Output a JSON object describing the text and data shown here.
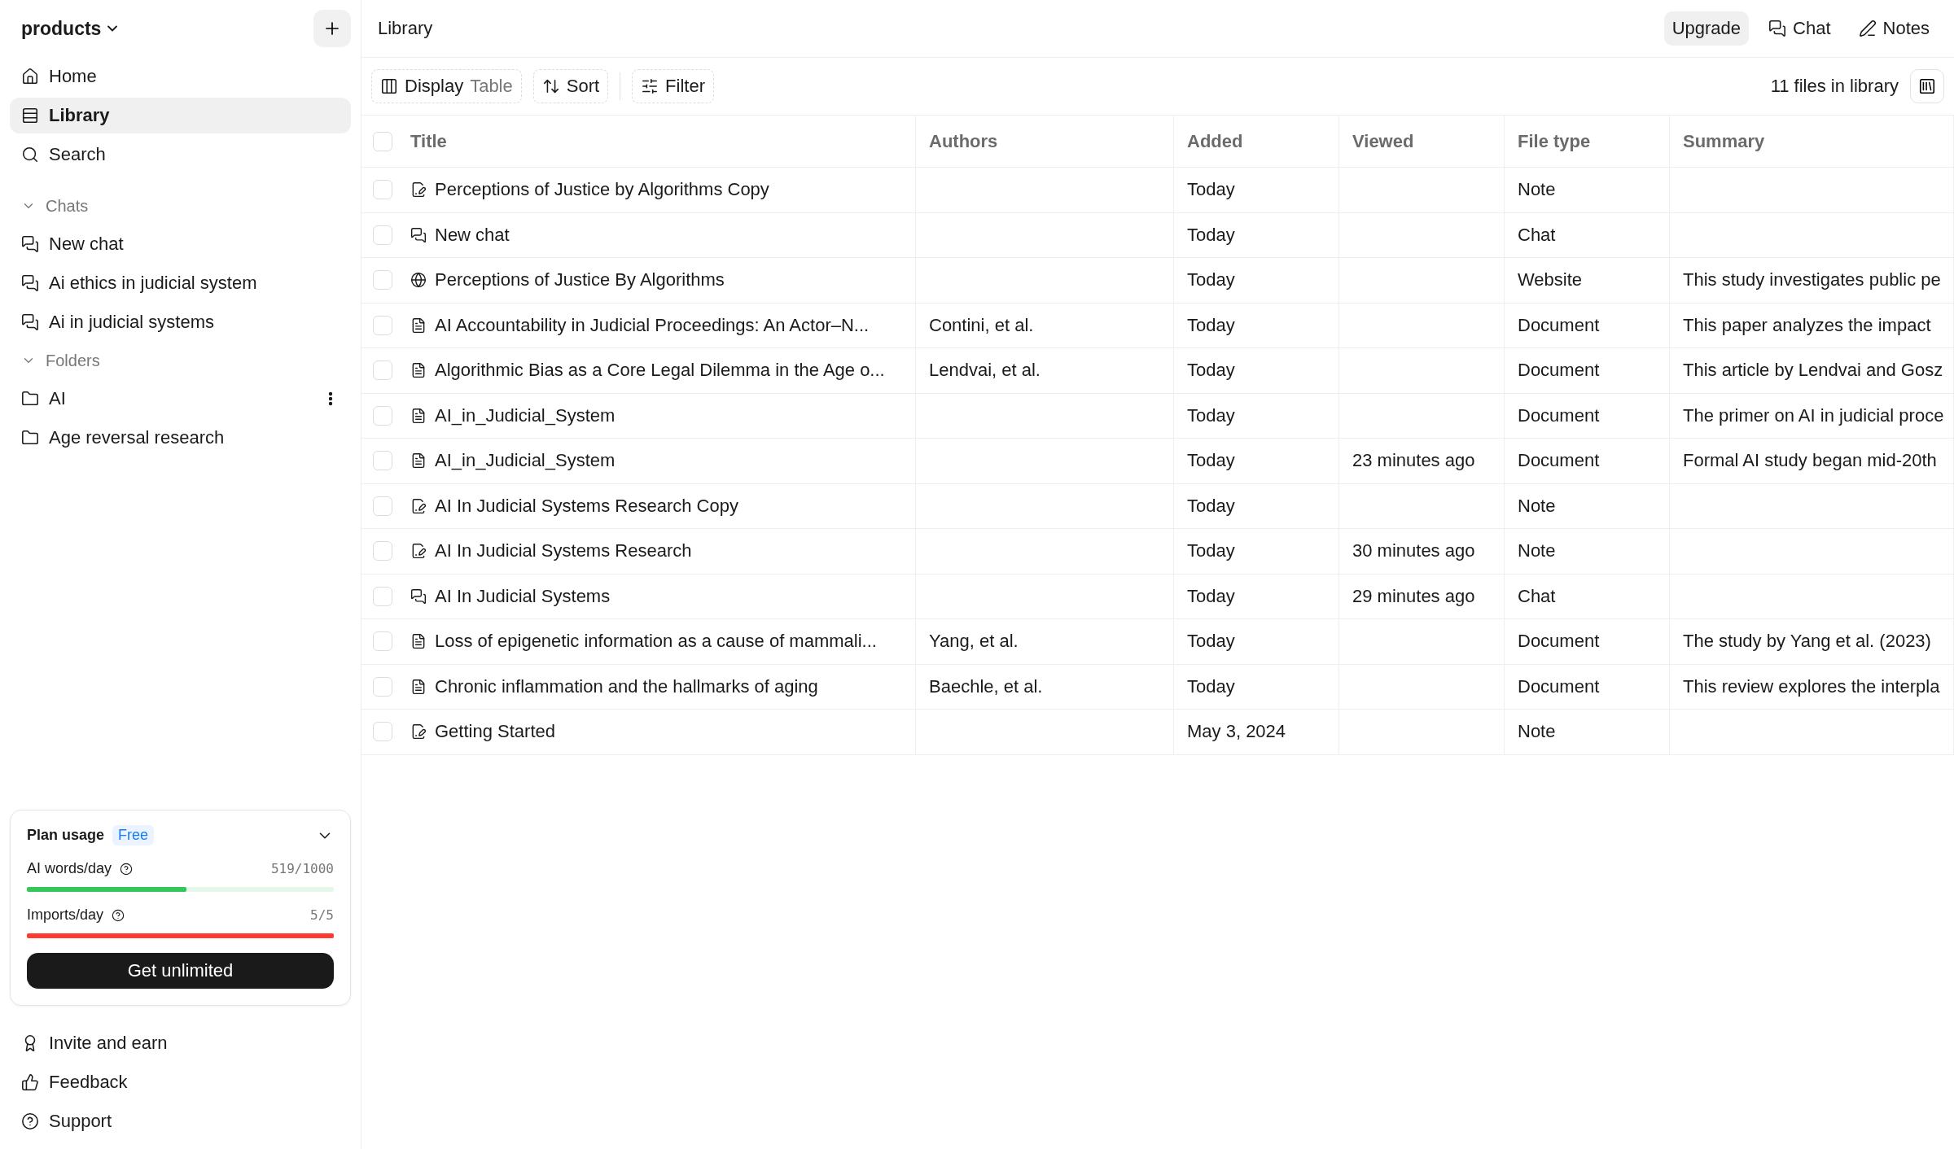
{
  "sidebar": {
    "workspace": "products",
    "nav": [
      {
        "label": "Home",
        "kind": "home",
        "selected": false
      },
      {
        "label": "Library",
        "kind": "library",
        "selected": true
      },
      {
        "label": "Search",
        "kind": "search",
        "selected": false
      }
    ],
    "sections": [
      {
        "title": "Chats",
        "expanded": true,
        "kind": "chat",
        "items": [
          {
            "label": "New chat"
          },
          {
            "label": "Ai ethics in judicial system"
          },
          {
            "label": "Ai in judicial systems"
          }
        ]
      },
      {
        "title": "Folders",
        "expanded": true,
        "kind": "folder",
        "items": [
          {
            "label": "AI",
            "menu": true
          },
          {
            "label": "Age reversal research"
          }
        ]
      }
    ],
    "plan": {
      "title": "Plan usage",
      "badge": "Free",
      "meters": [
        {
          "label": "AI words/day",
          "reading": "519/1000",
          "level": 0.519,
          "color": "#34c759"
        },
        {
          "label": "Imports/day",
          "reading": "5/5",
          "level": 1,
          "color": "#ff3b30"
        }
      ],
      "button": "Get unlimited"
    },
    "footer": [
      {
        "label": "Invite and earn",
        "kind": "award"
      },
      {
        "label": "Feedback",
        "kind": "like"
      },
      {
        "label": "Support",
        "kind": "help"
      }
    ]
  },
  "header": {
    "title": "Library",
    "actions": [
      {
        "label": "Upgrade",
        "kind": "plain"
      },
      {
        "label": "Chat",
        "kind": "chat"
      },
      {
        "label": "Notes",
        "kind": "notes"
      }
    ]
  },
  "toolbar": {
    "display": "Display",
    "display_value": "Table",
    "sort": "Sort",
    "filter": "Filter",
    "count": "11 files in library"
  },
  "table": {
    "columns": [
      "Title",
      "Authors",
      "Added",
      "Viewed",
      "File type",
      "Summary"
    ],
    "header_checked": false,
    "rows": [
      {
        "kind": "note",
        "checked": false,
        "cells": [
          "Perceptions of Justice by Algorithms Copy",
          "",
          "Today",
          "",
          "Note",
          ""
        ]
      },
      {
        "kind": "chat",
        "checked": false,
        "cells": [
          "New chat",
          "",
          "Today",
          "",
          "Chat",
          ""
        ]
      },
      {
        "kind": "website",
        "checked": false,
        "cells": [
          "Perceptions of Justice By Algorithms",
          "",
          "Today",
          "",
          "Website",
          "This study investigates public pe"
        ]
      },
      {
        "kind": "document",
        "checked": false,
        "cells": [
          "AI Accountability in Judicial Proceedings: An Actor–N...",
          "Contini, et al.",
          "Today",
          "",
          "Document",
          "This paper analyzes the impact"
        ]
      },
      {
        "kind": "document",
        "checked": false,
        "cells": [
          "Algorithmic Bias as a Core Legal Dilemma in the Age o...",
          "Lendvai, et al.",
          "Today",
          "",
          "Document",
          "This article by Lendvai and Gosz"
        ]
      },
      {
        "kind": "document",
        "checked": false,
        "cells": [
          "AI_in_Judicial_System",
          "",
          "Today",
          "",
          "Document",
          "The primer on AI in judicial proce"
        ]
      },
      {
        "kind": "document",
        "checked": false,
        "cells": [
          "AI_in_Judicial_System",
          "",
          "Today",
          "23 minutes ago",
          "Document",
          "Formal AI study began mid-20th"
        ]
      },
      {
        "kind": "note",
        "checked": false,
        "cells": [
          "AI In Judicial Systems Research Copy",
          "",
          "Today",
          "",
          "Note",
          ""
        ]
      },
      {
        "kind": "note",
        "checked": false,
        "cells": [
          "AI In Judicial Systems Research",
          "",
          "Today",
          "30 minutes ago",
          "Note",
          ""
        ]
      },
      {
        "kind": "chat",
        "checked": false,
        "cells": [
          "AI In Judicial Systems",
          "",
          "Today",
          "29 minutes ago",
          "Chat",
          ""
        ]
      },
      {
        "kind": "document",
        "checked": false,
        "cells": [
          "Loss of epigenetic information as a cause of mammali...",
          "Yang, et al.",
          "Today",
          "",
          "Document",
          "The study by Yang et al. (2023)"
        ]
      },
      {
        "kind": "document",
        "checked": false,
        "cells": [
          "Chronic inflammation and the hallmarks of aging",
          "Baechle, et al.",
          "Today",
          "",
          "Document",
          "This review explores the interpla"
        ]
      },
      {
        "kind": "note",
        "checked": false,
        "cells": [
          "Getting Started",
          "",
          "May 3, 2024",
          "",
          "Note",
          ""
        ]
      }
    ]
  }
}
